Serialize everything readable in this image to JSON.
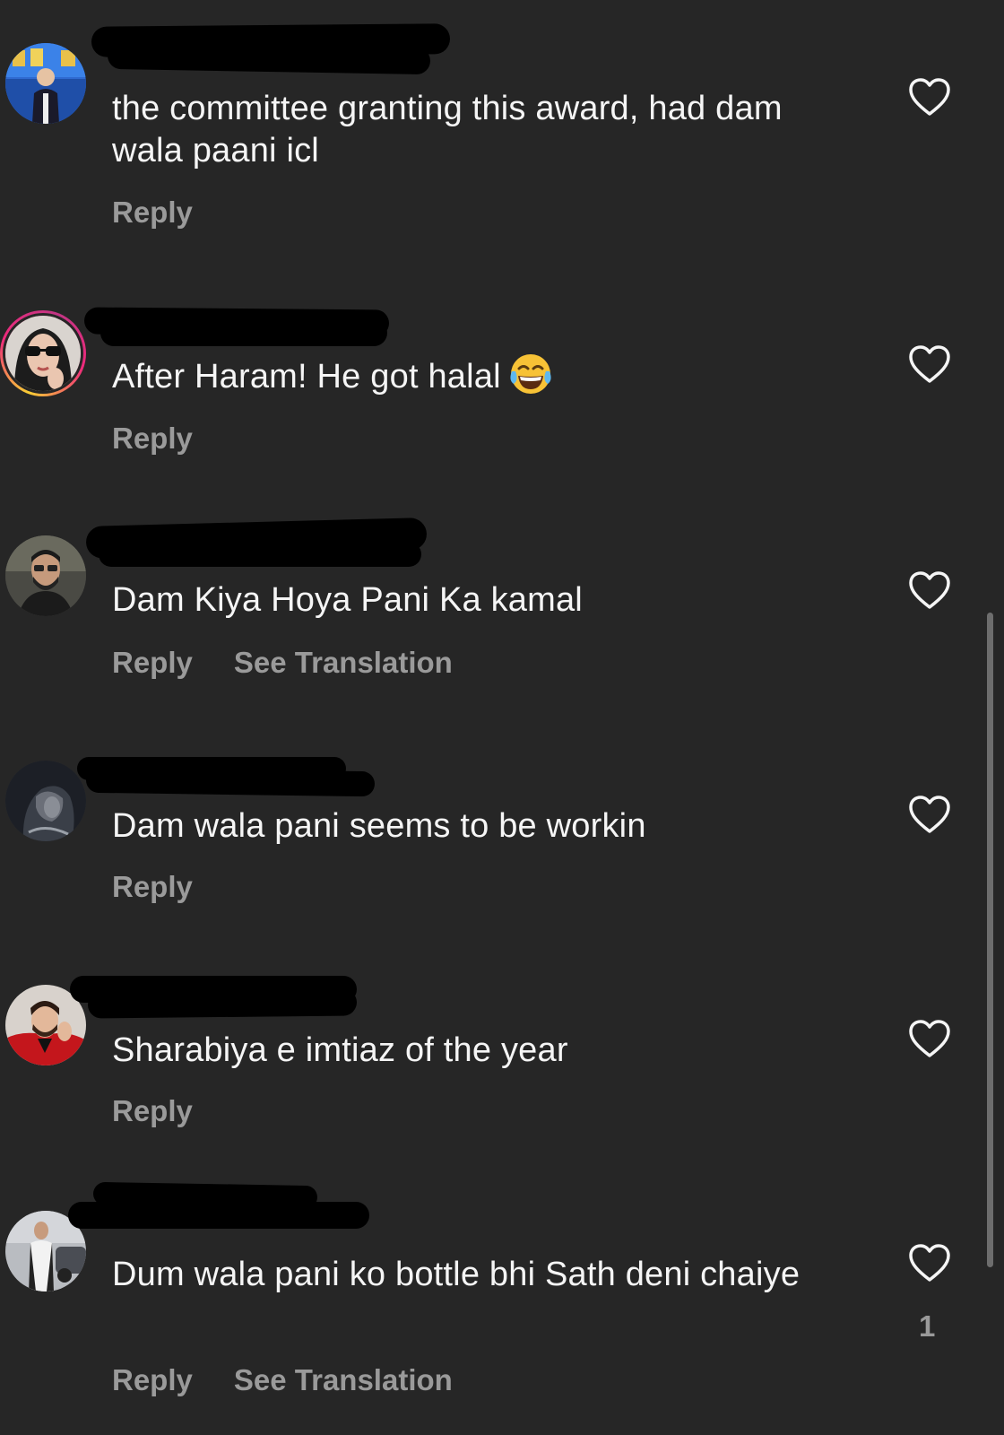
{
  "comments": [
    {
      "text": "the committee granting this award, had dam wala paani icl",
      "reply_label": "Reply",
      "see_translation_label": "",
      "likes": ""
    },
    {
      "text": "After Haram! He got halal",
      "emoji": "😂",
      "reply_label": "Reply",
      "see_translation_label": "",
      "likes": ""
    },
    {
      "text": "Dam Kiya Hoya Pani Ka kamal",
      "reply_label": "Reply",
      "see_translation_label": "See Translation",
      "likes": ""
    },
    {
      "text": "Dam wala pani seems to be workin",
      "reply_label": "Reply",
      "see_translation_label": "",
      "likes": ""
    },
    {
      "text": "Sharabiya e imtiaz of the year",
      "reply_label": "Reply",
      "see_translation_label": "",
      "likes": ""
    },
    {
      "text": "Dum wala pani ko bottle bhi Sath deni chaiye",
      "reply_label": "Reply",
      "see_translation_label": "See Translation",
      "likes": "1"
    }
  ],
  "icons": {
    "like": "heart-outline-icon"
  },
  "colors": {
    "background": "#262626",
    "text": "#f5f5f5",
    "secondary": "#9a9a9a"
  }
}
